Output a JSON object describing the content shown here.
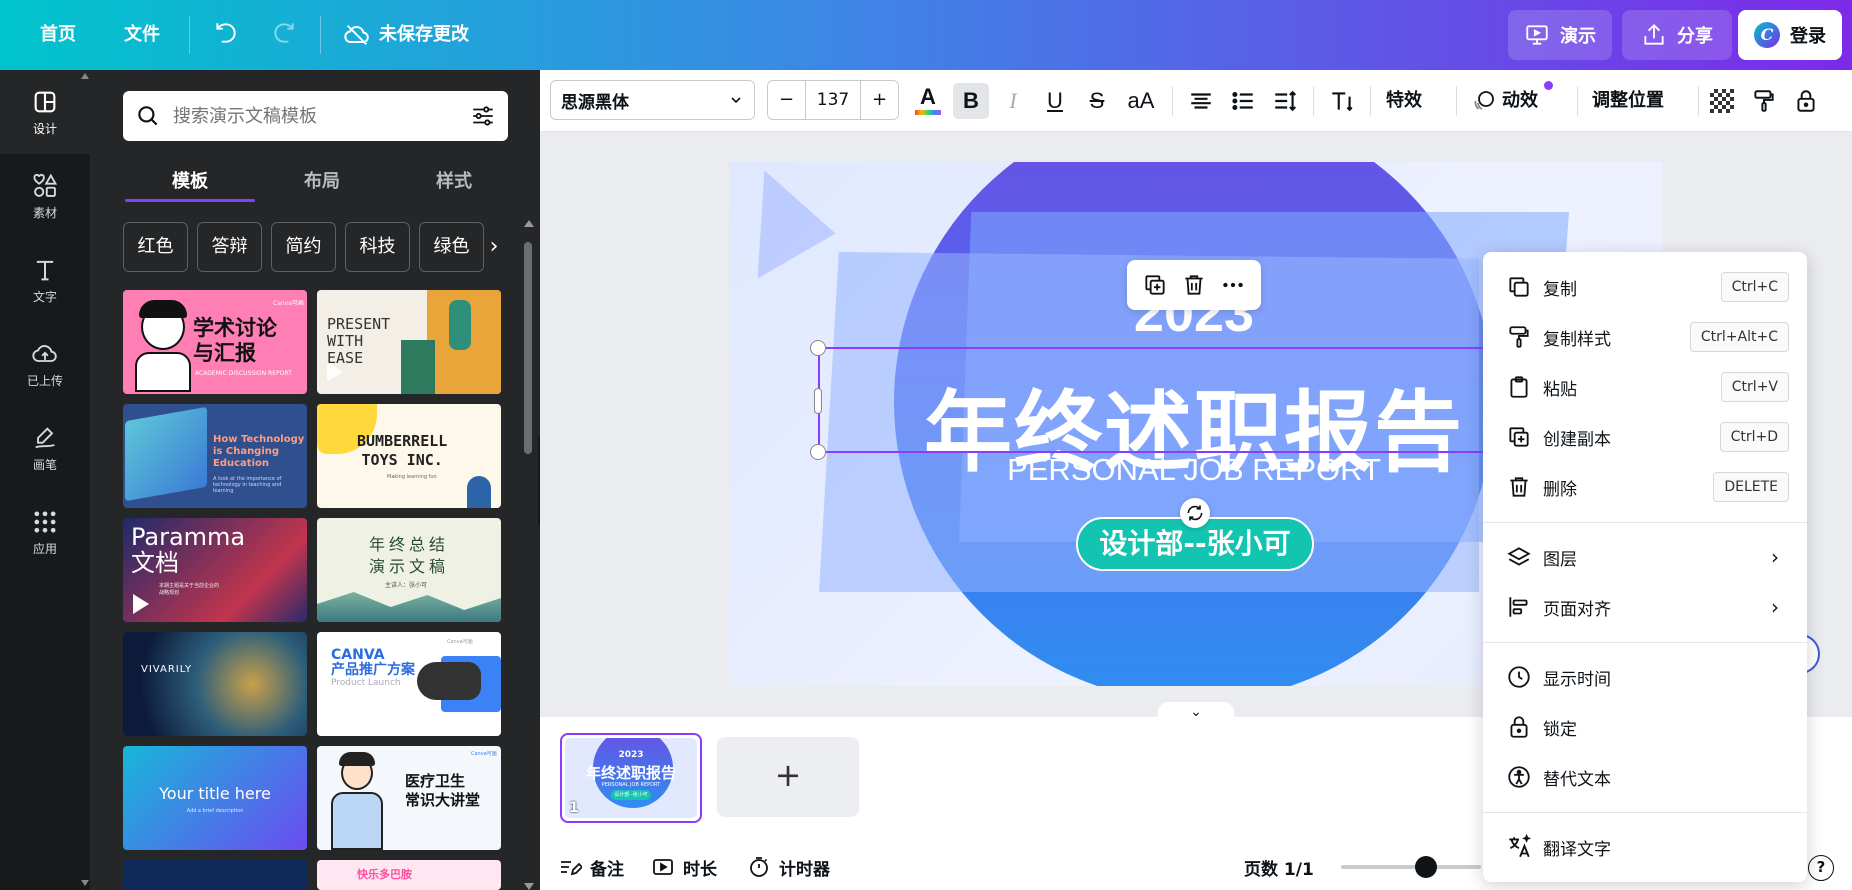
{
  "topbar": {
    "home": "首页",
    "file": "文件",
    "unsaved": "未保存更改",
    "present": "演示",
    "share": "分享",
    "login": "登录",
    "gradient": [
      "#00c4cc",
      "#3d87e6",
      "#7d2ae8"
    ]
  },
  "rail": {
    "items": [
      {
        "label": "设计",
        "icon": "design-icon",
        "active": true
      },
      {
        "label": "素材",
        "icon": "elements-icon"
      },
      {
        "label": "文字",
        "icon": "text-icon"
      },
      {
        "label": "已上传",
        "icon": "upload-cloud-icon"
      },
      {
        "label": "画笔",
        "icon": "draw-icon"
      },
      {
        "label": "应用",
        "icon": "apps-grid-icon"
      }
    ]
  },
  "panel": {
    "search_placeholder": "搜索演示文稿模板",
    "tabs": [
      "模板",
      "布局",
      "样式"
    ],
    "chips": [
      "红色",
      "答辩",
      "简约",
      "科技",
      "绿色"
    ],
    "templates": [
      {
        "title": "学术讨论\n与汇报",
        "sub": "ACADEMIC DISCUSSION REPORT",
        "brand": "Canva可画"
      },
      {
        "title": "PRESENT\nWITH\nEASE"
      },
      {
        "title": "How Technology\nis Changing\nEducation",
        "sub": "A look at the importance of technology in teaching and learning"
      },
      {
        "title": "BUMBERRELL\nTOYS INC.",
        "sub": "Making learning fun"
      },
      {
        "title": "Paramma\n文档",
        "sub": "本期主题是关于当前企业的\n战略规划"
      },
      {
        "title": "年终总结\n演示文稿",
        "sub": "主讲人：张小可"
      },
      {
        "title": "VIVARILY"
      },
      {
        "title": "CANVA\n产品推广方案",
        "sub": "Product Launch",
        "brand": "Canva可画"
      },
      {
        "title": "Your title here",
        "sub": "Add a brief description"
      },
      {
        "title": "医疗卫生\n常识大讲堂",
        "brand": "Canva可画"
      },
      {
        "title": ""
      },
      {
        "title": "快乐多巴胺"
      }
    ]
  },
  "toolbar": {
    "font": "思源黑体",
    "size": "137",
    "minus": "−",
    "plus": "+",
    "case": "aA",
    "effects": "特效",
    "animate": "动效",
    "position": "调整位置",
    "text_color": "#0e1318"
  },
  "slide": {
    "year": "2023",
    "title": "年终述职报告",
    "subtitle": "PERSONAL JOB REPORT",
    "presenter": "设计部--张小可"
  },
  "context_menu": {
    "items": [
      {
        "label": "复制",
        "shortcut": "Ctrl+C",
        "icon": "copy-icon"
      },
      {
        "label": "复制样式",
        "shortcut": "Ctrl+Alt+C",
        "icon": "paint-roller-icon"
      },
      {
        "label": "粘贴",
        "shortcut": "Ctrl+V",
        "icon": "clipboard-icon"
      },
      {
        "label": "创建副本",
        "shortcut": "Ctrl+D",
        "icon": "duplicate-icon"
      },
      {
        "label": "删除",
        "shortcut": "DELETE",
        "icon": "trash-icon"
      },
      {
        "label": "图层",
        "icon": "layers-icon",
        "submenu": true
      },
      {
        "label": "页面对齐",
        "icon": "align-left-icon",
        "submenu": true
      },
      {
        "label": "显示时间",
        "icon": "clock-icon"
      },
      {
        "label": "锁定",
        "icon": "lock-icon"
      },
      {
        "label": "替代文本",
        "icon": "accessibility-icon"
      },
      {
        "label": "翻译文字",
        "icon": "translate-icon"
      }
    ]
  },
  "pages": {
    "thumb_number": "1",
    "thumb_year": "2023",
    "thumb_title": "年终述职报告",
    "thumb_sub": "PERSONAL JOB REPORT",
    "thumb_presenter": "设计部--张小可",
    "add_symbol": "+"
  },
  "footer": {
    "notes": "备注",
    "duration": "时长",
    "timer": "计时器",
    "page_count": "页数 1/1",
    "help": "?"
  },
  "colors": {
    "accent": "#8b3dff",
    "panel_bg": "#252627",
    "rail_bg": "#18191b",
    "teal": "#13c4b0"
  }
}
